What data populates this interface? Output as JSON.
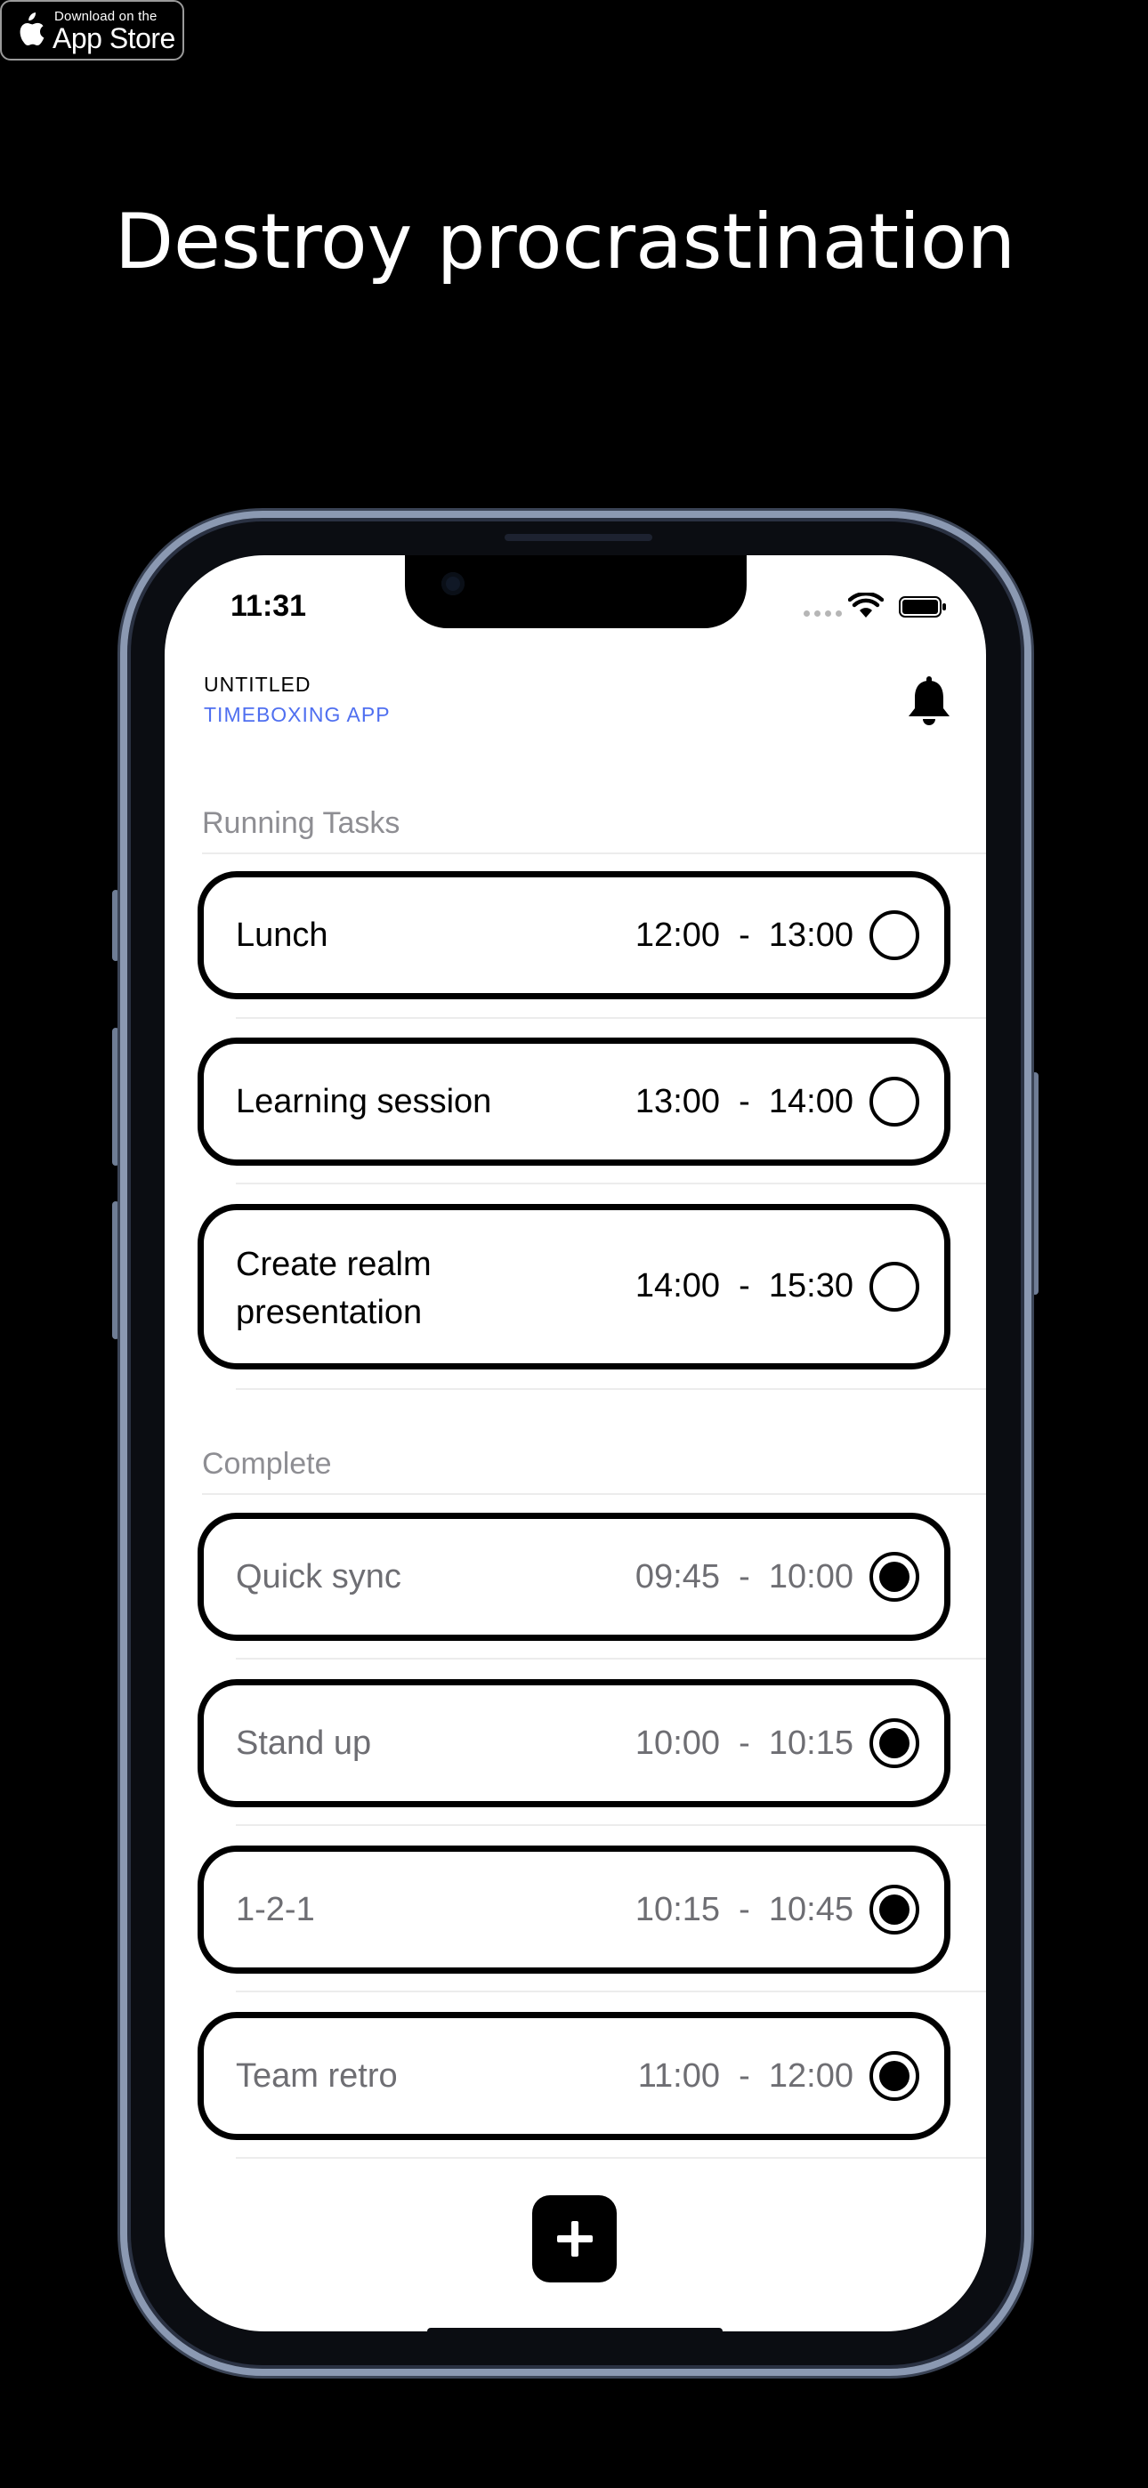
{
  "store_badge": {
    "line1": "Download on the",
    "line2": "App Store",
    "icon": "apple-icon"
  },
  "headline": "Destroy procrastination",
  "status_bar": {
    "time": "11:31",
    "icons": [
      "signal-icon",
      "wifi-icon",
      "battery-icon"
    ]
  },
  "app": {
    "title": "UNTITLED",
    "subtitle": "TIMEBOXING APP",
    "subtitle_color": "#4f6ff0",
    "notification_icon": "bell-icon"
  },
  "running": {
    "header": "Running Tasks",
    "tasks": [
      {
        "name": "Lunch",
        "start": "12:00",
        "end": "13:00",
        "done": false
      },
      {
        "name": "Learning session",
        "start": "13:00",
        "end": "14:00",
        "done": false
      },
      {
        "name": "Create realm\npresentation",
        "start": "14:00",
        "end": "15:30",
        "done": false
      }
    ]
  },
  "complete": {
    "header": "Complete",
    "tasks": [
      {
        "name": "Quick sync",
        "start": "09:45",
        "end": "10:00",
        "done": true
      },
      {
        "name": "Stand up",
        "start": "10:00",
        "end": "10:15",
        "done": true
      },
      {
        "name": "1-2-1",
        "start": "10:15",
        "end": "10:45",
        "done": true
      },
      {
        "name": "Team retro",
        "start": "11:00",
        "end": "12:00",
        "done": true
      }
    ]
  },
  "add_button": {
    "icon": "plus-icon"
  }
}
